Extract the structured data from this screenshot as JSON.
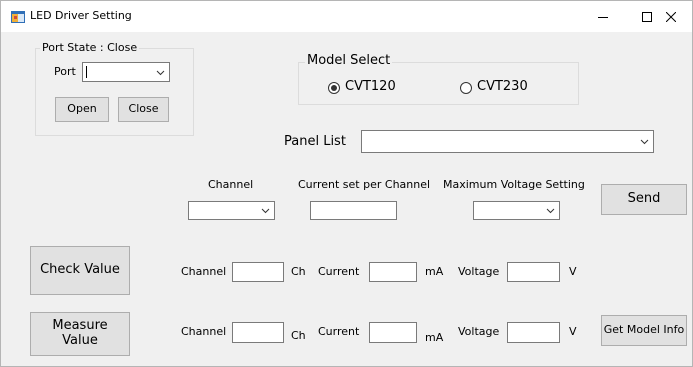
{
  "window": {
    "title": "LED Driver Setting"
  },
  "port_group": {
    "legend": "Port State : Close",
    "port_label": "Port",
    "port_value": "",
    "open_label": "Open",
    "close_label": "Close"
  },
  "model_group": {
    "legend": "Model Select",
    "options": [
      {
        "label": "CVT120",
        "checked": true
      },
      {
        "label": "CVT230",
        "checked": false
      }
    ]
  },
  "panel": {
    "label": "Panel List",
    "value": ""
  },
  "settings": {
    "channel_header": "Channel",
    "current_header": "Current set per Channel",
    "voltage_header": "Maximum Voltage Setting",
    "channel_value": "",
    "current_value": "",
    "voltage_value": "",
    "send_label": "Send"
  },
  "check_row": {
    "button_label": "Check Value",
    "channel_label": "Channel",
    "channel_value": "",
    "channel_unit": "Ch",
    "current_label": "Current",
    "current_value": "",
    "current_unit": "mA",
    "voltage_label": "Voltage",
    "voltage_value": "",
    "voltage_unit": "V"
  },
  "measure_row": {
    "button_label_line1": "Measure",
    "button_label_line2": "Value",
    "channel_label": "Channel",
    "channel_value": "",
    "channel_unit": "Ch",
    "current_label": "Current",
    "current_value": "",
    "current_unit": "mA",
    "voltage_label": "Voltage",
    "voltage_value": "",
    "voltage_unit": "V",
    "get_model_label": "Get Model Info"
  },
  "icons": {
    "app": "app-window-icon",
    "minimize": "minimize-icon",
    "maximize": "maximize-icon",
    "close": "close-icon",
    "dropdown": "chevron-down-icon"
  },
  "colors": {
    "window_bg": "#f0f0f0",
    "button_bg": "#e1e1e1",
    "border": "#7a7a7a"
  }
}
